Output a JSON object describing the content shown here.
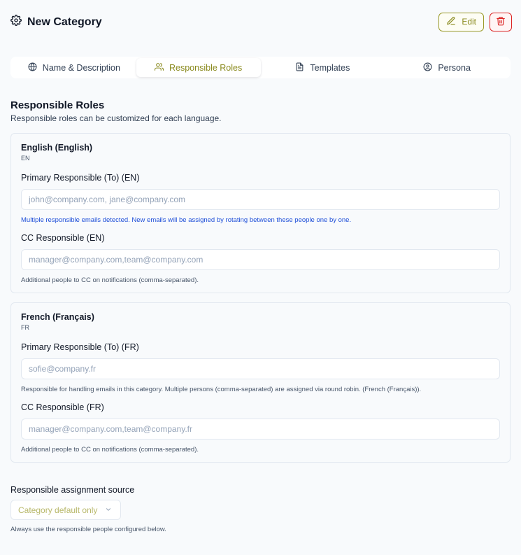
{
  "header": {
    "title": "New Category",
    "edit_label": "Edit"
  },
  "tabs": [
    {
      "label": "Name & Description",
      "icon": "globe-icon",
      "active": false
    },
    {
      "label": "Responsible Roles",
      "icon": "users-icon",
      "active": true
    },
    {
      "label": "Templates",
      "icon": "document-icon",
      "active": false
    },
    {
      "label": "Persona",
      "icon": "user-circle-icon",
      "active": false
    }
  ],
  "section": {
    "title": "Responsible Roles",
    "description": "Responsible roles can be customized for each language."
  },
  "languages": [
    {
      "name": "English (English)",
      "code": "EN",
      "primary_label": "Primary Responsible (To) (EN)",
      "primary_placeholder": "john@company.com, jane@company.com",
      "primary_hint": "Multiple responsible emails detected. New emails will be assigned by rotating between these people one by one.",
      "cc_label": "CC Responsible (EN)",
      "cc_placeholder": "manager@company.com,team@company.com",
      "cc_hint": "Additional people to CC on notifications (comma-separated)."
    },
    {
      "name": "French (Français)",
      "code": "FR",
      "primary_label": "Primary Responsible (To) (FR)",
      "primary_placeholder": "sofie@company.fr",
      "primary_hint": "Responsible for handling emails in this category. Multiple persons (comma-separated) are assigned via round robin. (French (Français)).",
      "cc_label": "CC Responsible (FR)",
      "cc_placeholder": "manager@company.com,team@company.fr",
      "cc_hint": "Additional people to CC on notifications (comma-separated)."
    }
  ],
  "assignment": {
    "label": "Responsible assignment source",
    "selected": "Category default only",
    "hint": "Always use the responsible people configured below."
  },
  "colors": {
    "accent": "#8a8a1e",
    "danger": "#dc2626",
    "info": "#1d4ed8"
  }
}
